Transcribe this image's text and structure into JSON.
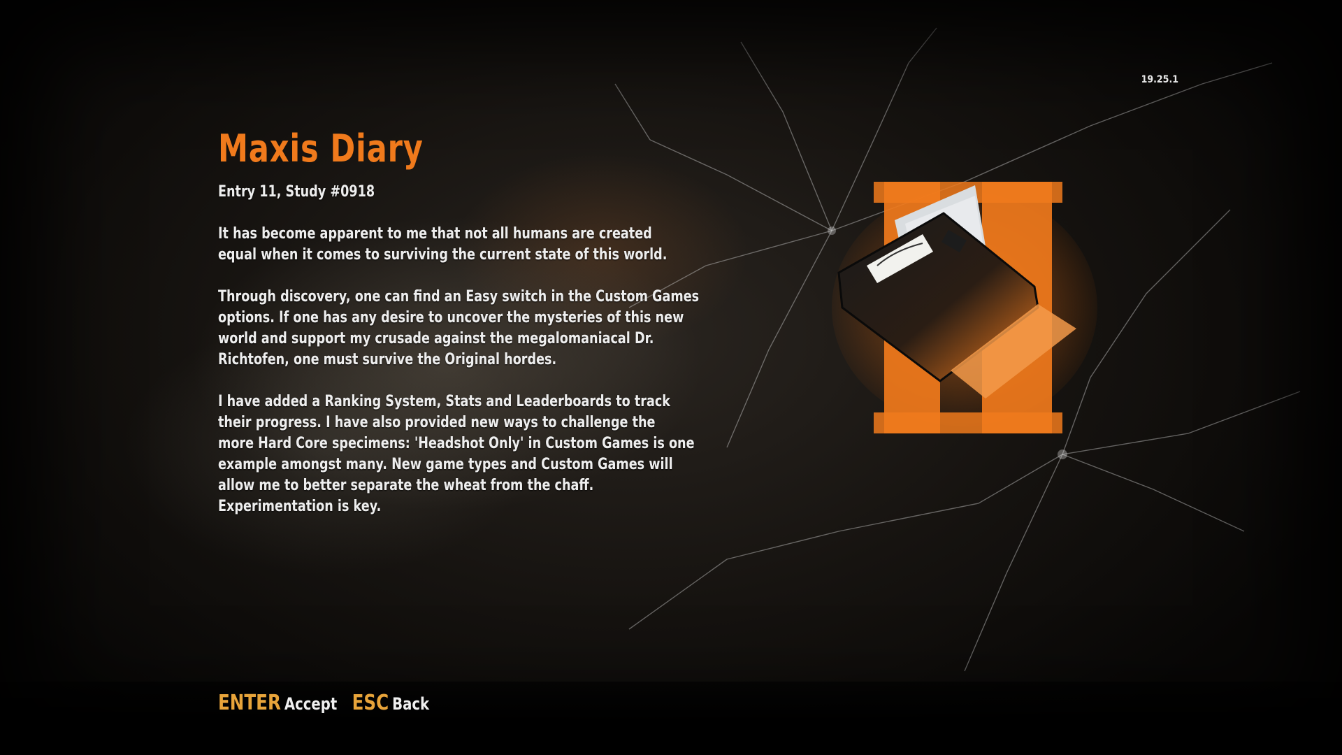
{
  "version": "19.25.1",
  "diary": {
    "title": "Maxis Diary",
    "entry": "Entry 11, Study #0918",
    "paragraphs": [
      "It has become apparent to me that not all humans are created\nequal when it comes to surviving the current state of this world.",
      "Through discovery, one can find an Easy switch in the Custom Games\noptions. If one has any desire to uncover the mysteries of this new\nworld and support my crusade against the megalomaniacal Dr.\nRichtofen, one must survive the Original hordes.",
      "I have added a Ranking System, Stats and Leaderboards to track\ntheir progress. I have also provided new ways to challenge the\nmore Hard Core specimens: 'Headshot Only' in Custom Games is one\nexample amongst many. New game types and Custom Games will\nallow me to better separate the wheat from the chaff.\nExperimentation is key."
    ]
  },
  "emblem": {
    "icon": "maxis-diary-folder-icon",
    "accent_color": "#f07a1c"
  },
  "footer": {
    "accept_key": "ENTER",
    "accept_label": "Accept",
    "back_key": "ESC",
    "back_label": "Back"
  },
  "colors": {
    "title": "#f07a1c",
    "key_prompt": "#e8a43a",
    "body_text": "#eeeeee"
  }
}
